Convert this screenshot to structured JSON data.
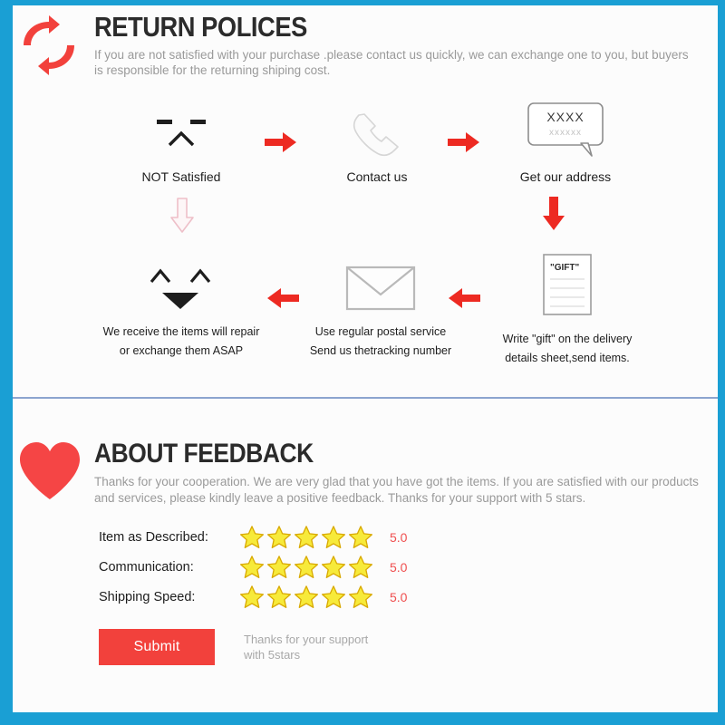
{
  "theme": {
    "border_blue": "#1a9fd4",
    "accent_red": "#f2413c",
    "heart_red": "#f54545",
    "star_yellow": "#f7ea3a",
    "star_outline": "#d8a800",
    "score_red": "#ef4f4f",
    "divider_blue": "#8ca5cf",
    "muted_text": "#9a9a9a",
    "page_bg": "#fcfcfc"
  },
  "return_section": {
    "logo_icon": "return-arrows-icon",
    "title": "RETURN POLICES",
    "description_line1": "If you are not satisfied with your purchase .please contact us quickly, we can exchange one to you,",
    "description_line2": "but buyers is responsible for the returning shiping cost.",
    "steps": [
      {
        "icon": "sad-face-icon",
        "caption": "NOT Satisfied"
      },
      {
        "icon": "telephone-icon",
        "caption": "Contact us"
      },
      {
        "icon": "speech-bubble-icon",
        "caption": "Get our address",
        "bubble_text_top": "XXXX",
        "bubble_text_bottom": "xxxxxx"
      },
      {
        "icon": "gift-document-icon",
        "caption_line1": "Write \"gift\" on the delivery",
        "caption_line2": "details sheet,send items.",
        "doc_label": "\"GIFT\""
      },
      {
        "icon": "envelope-icon",
        "caption_line1": "Use regular postal service",
        "caption_line2": "Send us thetracking number"
      },
      {
        "icon": "happy-face-icon",
        "caption_line1": "We receive the items will repair",
        "caption_line2": "or exchange them ASAP"
      }
    ],
    "arrows": [
      {
        "name": "arrow-right-1",
        "direction": "right",
        "style": "solid-red"
      },
      {
        "name": "arrow-right-2",
        "direction": "right",
        "style": "solid-red"
      },
      {
        "name": "arrow-down-right",
        "direction": "down",
        "style": "solid-red"
      },
      {
        "name": "arrow-left-1",
        "direction": "left",
        "style": "solid-red"
      },
      {
        "name": "arrow-left-2",
        "direction": "left",
        "style": "solid-red"
      },
      {
        "name": "arrow-down-left",
        "direction": "down",
        "style": "outline-pink"
      }
    ]
  },
  "feedback_section": {
    "heart_icon": "heart-icon",
    "title": "ABOUT FEEDBACK",
    "description_line1": "Thanks for your cooperation. We are very glad that you have got the items. If you are satisfied with our",
    "description_line2": "products and services, please kindly leave a positive feedback. Thanks for your support with 5 stars.",
    "ratings": [
      {
        "label": "Item as Described:",
        "stars": 5,
        "score": "5.0"
      },
      {
        "label": "Communication:",
        "stars": 5,
        "score": "5.0"
      },
      {
        "label": "Shipping Speed:",
        "stars": 5,
        "score": "5.0"
      }
    ],
    "submit_label": "Submit",
    "submit_note_line1": "Thanks for your support",
    "submit_note_line2": "with 5stars"
  }
}
